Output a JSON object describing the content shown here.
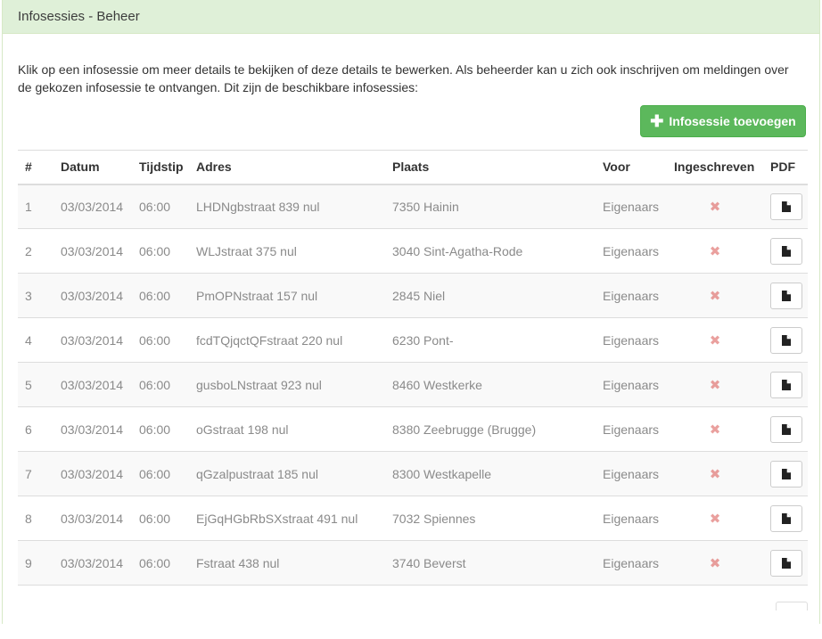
{
  "panel": {
    "title": "Infosessies - Beheer",
    "intro": "Klik op een infosessie om meer details te bekijken of deze details te bewerken. Als beheerder kan u zich ook inschrijven om meldingen over de gekozen infosessie te ontvangen. Dit zijn de beschikbare infosessies:",
    "add_button": {
      "icon": "plus-icon",
      "glyph": "✚",
      "label": "Infosessie toevoegen"
    }
  },
  "table": {
    "headers": {
      "num": "#",
      "date": "Datum",
      "time": "Tijdstip",
      "address": "Adres",
      "city": "Plaats",
      "for": "Voor",
      "registered": "Ingeschreven",
      "pdf": "PDF"
    },
    "registered_icon": "cross-icon",
    "registered_glyph": "✖",
    "pdf_icon": "document-icon",
    "rows": [
      {
        "num": "1",
        "date": "03/03/2014",
        "time": "06:00",
        "address": "LHDNgbstraat 839 nul",
        "city": "7350 Hainin",
        "for": "Eigenaars"
      },
      {
        "num": "2",
        "date": "03/03/2014",
        "time": "06:00",
        "address": "WLJstraat 375 nul",
        "city": "3040 Sint-Agatha-Rode",
        "for": "Eigenaars"
      },
      {
        "num": "3",
        "date": "03/03/2014",
        "time": "06:00",
        "address": "PmOPNstraat 157 nul",
        "city": "2845 Niel",
        "for": "Eigenaars"
      },
      {
        "num": "4",
        "date": "03/03/2014",
        "time": "06:00",
        "address": "fcdTQjqctQFstraat 220 nul",
        "city": "6230 Pont-",
        "for": "Eigenaars"
      },
      {
        "num": "5",
        "date": "03/03/2014",
        "time": "06:00",
        "address": "gusboLNstraat 923 nul",
        "city": "8460 Westkerke",
        "for": "Eigenaars"
      },
      {
        "num": "6",
        "date": "03/03/2014",
        "time": "06:00",
        "address": "oGstraat 198 nul",
        "city": "8380 Zeebrugge (Brugge)",
        "for": "Eigenaars"
      },
      {
        "num": "7",
        "date": "03/03/2014",
        "time": "06:00",
        "address": "qGzalpustraat 185 nul",
        "city": "8300 Westkapelle",
        "for": "Eigenaars"
      },
      {
        "num": "8",
        "date": "03/03/2014",
        "time": "06:00",
        "address": "EjGqHGbRbSXstraat 491 nul",
        "city": "7032 Spiennes",
        "for": "Eigenaars"
      },
      {
        "num": "9",
        "date": "03/03/2014",
        "time": "06:00",
        "address": "Fstraat 438 nul",
        "city": "3740 Beverst",
        "for": "Eigenaars"
      }
    ]
  },
  "colors": {
    "heading_bg": "#dff0d8",
    "success": "#5cb85c",
    "danger": "#d9534f"
  }
}
